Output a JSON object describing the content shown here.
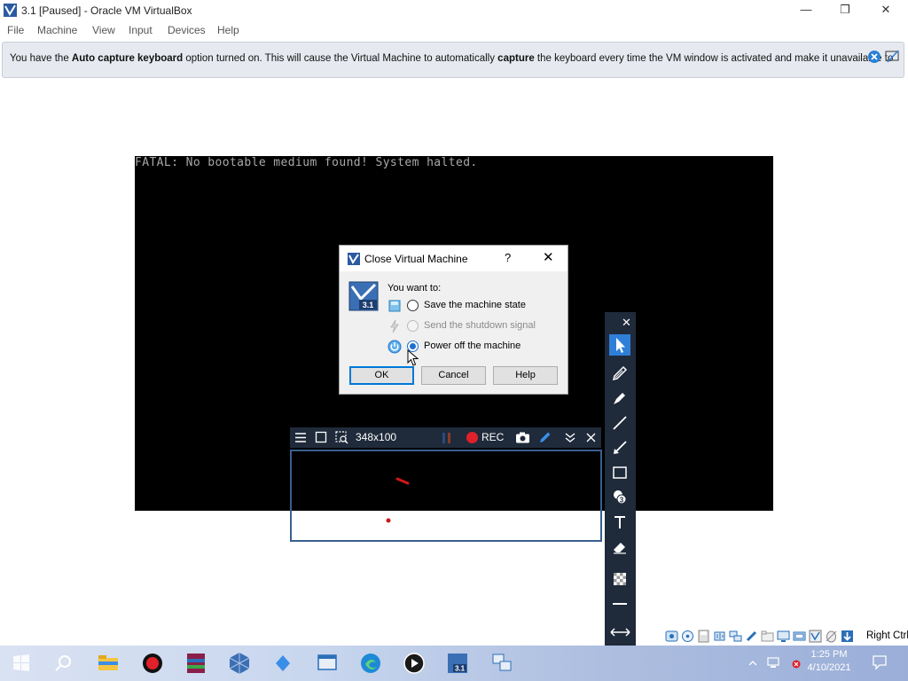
{
  "window": {
    "title": "3.1 [Paused] - Oracle VM VirtualBox",
    "minimize": "—",
    "maximize": "❐",
    "close": "✕"
  },
  "menu": [
    "File",
    "Machine",
    "View",
    "Input",
    "Devices",
    "Help"
  ],
  "notice": {
    "prefix": "You have the ",
    "bold1": "Auto capture keyboard",
    "mid1": " option turned on. This will cause the Virtual Machine to automatically ",
    "bold2": "capture",
    "suffix": " the keyboard every time the VM window is activated and make it unavailable to"
  },
  "vm_console": {
    "text": "FATAL: No bootable medium found! System halted."
  },
  "dialog": {
    "title": "Close Virtual Machine",
    "help_glyph": "?",
    "close_glyph": "✕",
    "icon_label": "3.1",
    "prompt": "You want to:",
    "options": [
      {
        "label": "Save the machine state",
        "checked": false,
        "disabled": false
      },
      {
        "label": "Send the shutdown signal",
        "checked": false,
        "disabled": true
      },
      {
        "label": "Power off the machine",
        "checked": true,
        "disabled": false
      }
    ],
    "buttons": {
      "ok": "OK",
      "cancel": "Cancel",
      "help": "Help"
    }
  },
  "capture_tool": {
    "size": "348x100",
    "rec": "REC",
    "close_glyph": "✕",
    "collapse_glyph": "⌄"
  },
  "draw_toolbar": {
    "close_glyph": "✕",
    "tools": [
      "pointer",
      "pencil",
      "marker",
      "line",
      "arrow",
      "rectangle",
      "counter",
      "text",
      "eraser",
      "opacity",
      "line-width"
    ]
  },
  "statusbar": {
    "host_key": "Right Ctrl"
  },
  "taskbar": {
    "clock": "1:25 PM",
    "date": "4/10/2021"
  },
  "colors": {
    "accent": "#0078d7",
    "record_red": "#e0202a",
    "toolbar_dark": "#1f2a3a"
  }
}
